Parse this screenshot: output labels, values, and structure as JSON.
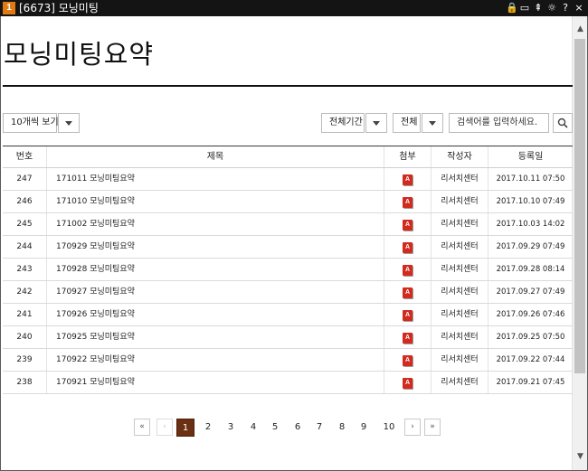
{
  "titlebar": {
    "badge": "1",
    "title": "[6673] 모닝미팅",
    "icons": [
      "lock-icon",
      "clipboard-icon",
      "pin-icon",
      "settings-icon",
      "help-icon",
      "close-icon"
    ],
    "icon_glyphs": [
      "🔒",
      "▭",
      "⇞",
      "☼",
      "?",
      "×"
    ]
  },
  "page": {
    "title": "모닝미팅요약"
  },
  "toolbar": {
    "page_size_label": "10개씩 보기",
    "period_label": "전체기간",
    "scope_label": "전체",
    "search_placeholder": "검색어를 입력하세요."
  },
  "table": {
    "headers": {
      "num": "번호",
      "title": "제목",
      "attachment": "첨부",
      "author": "작성자",
      "date": "등록일"
    },
    "rows": [
      {
        "num": "247",
        "title": "171011 모닝미팅요약",
        "author": "리서치센터",
        "date": "2017.10.11 07:50"
      },
      {
        "num": "246",
        "title": "171010 모닝미팅요약",
        "author": "리서치센터",
        "date": "2017.10.10 07:49"
      },
      {
        "num": "245",
        "title": "171002 모닝미팅요약",
        "author": "리서치센터",
        "date": "2017.10.03 14:02"
      },
      {
        "num": "244",
        "title": "170929 모닝미팅요약",
        "author": "리서치센터",
        "date": "2017.09.29 07:49"
      },
      {
        "num": "243",
        "title": "170928 모닝미팅요약",
        "author": "리서치센터",
        "date": "2017.09.28 08:14"
      },
      {
        "num": "242",
        "title": "170927 모닝미팅요약",
        "author": "리서치센터",
        "date": "2017.09.27 07:49"
      },
      {
        "num": "241",
        "title": "170926 모닝미팅요약",
        "author": "리서치센터",
        "date": "2017.09.26 07:46"
      },
      {
        "num": "240",
        "title": "170925 모닝미팅요약",
        "author": "리서치센터",
        "date": "2017.09.25 07:50"
      },
      {
        "num": "239",
        "title": "170922 모닝미팅요약",
        "author": "리서치센터",
        "date": "2017.09.22 07:44"
      },
      {
        "num": "238",
        "title": "170921 모닝미팅요약",
        "author": "리서치센터",
        "date": "2017.09.21 07:45"
      }
    ]
  },
  "pagination": {
    "first": "«",
    "prev": "‹",
    "pages": [
      "1",
      "2",
      "3",
      "4",
      "5",
      "6",
      "7",
      "8",
      "9",
      "10"
    ],
    "active": "1",
    "next": "›",
    "last": "»"
  },
  "colors": {
    "active_page": "#6b2f12",
    "app_badge": "#e07b14",
    "pdf_icon": "#d12a1f"
  }
}
